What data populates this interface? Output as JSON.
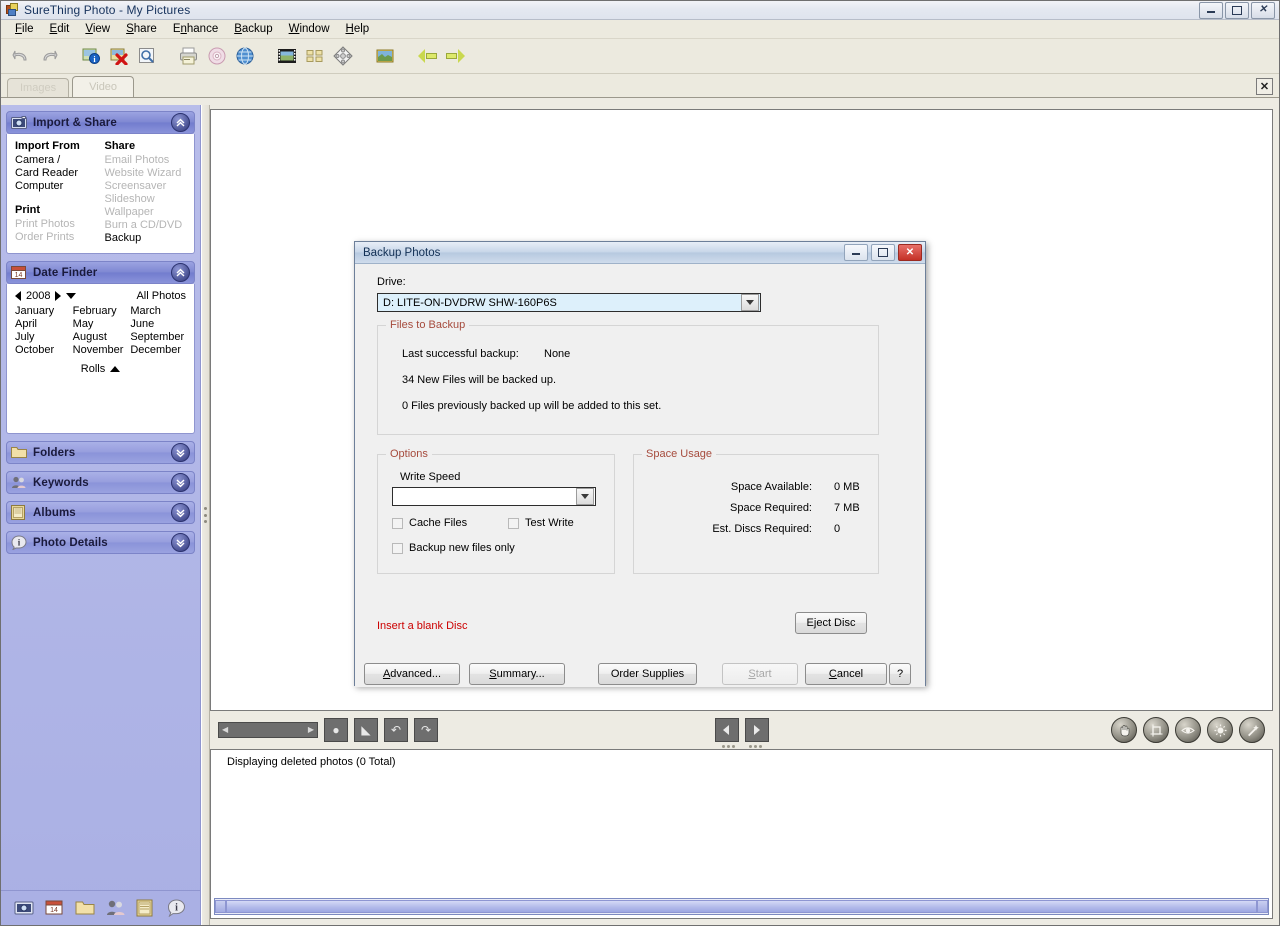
{
  "window": {
    "title": "SureThing Photo - My Pictures",
    "minimize": "Minimize",
    "restore": "Restore",
    "close": "Close"
  },
  "menubar": {
    "items": [
      {
        "label": "File",
        "accel": "F"
      },
      {
        "label": "Edit",
        "accel": "E"
      },
      {
        "label": "View",
        "accel": "V"
      },
      {
        "label": "Share",
        "accel": "S"
      },
      {
        "label": "Enhance",
        "accel": "n"
      },
      {
        "label": "Backup",
        "accel": "B"
      },
      {
        "label": "Window",
        "accel": "W"
      },
      {
        "label": "Help",
        "accel": "H"
      }
    ]
  },
  "toolbar": {
    "buttons": [
      {
        "name": "undo-icon"
      },
      {
        "name": "redo-icon"
      },
      {
        "name": "photo-info-icon"
      },
      {
        "name": "delete-photo-icon"
      },
      {
        "name": "search-icon"
      },
      {
        "name": "print-icon"
      },
      {
        "name": "burn-disc-icon"
      },
      {
        "name": "web-globe-icon"
      },
      {
        "name": "filmstrip-view-icon"
      },
      {
        "name": "thumbnail-view-icon"
      },
      {
        "name": "puzzle-icon"
      },
      {
        "name": "image-icon"
      },
      {
        "name": "back-arrow-icon"
      },
      {
        "name": "forward-arrow-icon"
      }
    ]
  },
  "tabs": {
    "items": [
      {
        "label": "Images",
        "active": false
      },
      {
        "label": "Video",
        "active": true
      }
    ],
    "close_label": "✕"
  },
  "sidebar": {
    "panels": [
      {
        "id": "import-share",
        "title": "Import & Share",
        "icon": "camera-icon",
        "expanded": true,
        "toggle": "«"
      },
      {
        "id": "date-finder",
        "title": "Date Finder",
        "icon": "calendar-icon",
        "expanded": true,
        "toggle": "«"
      },
      {
        "id": "folders",
        "title": "Folders",
        "icon": "folder-icon",
        "expanded": false,
        "toggle": "»"
      },
      {
        "id": "keywords",
        "title": "Keywords",
        "icon": "people-icon",
        "expanded": false,
        "toggle": "»"
      },
      {
        "id": "albums",
        "title": "Albums",
        "icon": "album-icon",
        "expanded": false,
        "toggle": "»"
      },
      {
        "id": "photo-details",
        "title": "Photo Details",
        "icon": "info-icon",
        "expanded": false,
        "toggle": "»"
      }
    ],
    "import_share": {
      "col1_header": "Import From",
      "col1_items": [
        {
          "label": "Camera /",
          "disabled": false
        },
        {
          "label": "Card Reader",
          "disabled": false
        },
        {
          "label": "Computer",
          "disabled": false
        }
      ],
      "col1_header2": "Print",
      "col1_items2": [
        {
          "label": "Print Photos",
          "disabled": true
        },
        {
          "label": "Order Prints",
          "disabled": true
        }
      ],
      "col2_header": "Share",
      "col2_items": [
        {
          "label": "Email Photos",
          "disabled": true
        },
        {
          "label": "Website Wizard",
          "disabled": true
        },
        {
          "label": "Screensaver",
          "disabled": true
        },
        {
          "label": "Slideshow",
          "disabled": true
        },
        {
          "label": "Wallpaper",
          "disabled": true
        },
        {
          "label": "Burn a CD/DVD",
          "disabled": true
        },
        {
          "label": "Backup",
          "disabled": false
        }
      ]
    },
    "date_finder": {
      "year": "2008",
      "prev": "◁",
      "next": "▷",
      "dropdown": "▽",
      "all_photos": "All Photos",
      "months": [
        "January",
        "February",
        "March",
        "April",
        "May",
        "June",
        "July",
        "August",
        "September",
        "October",
        "November",
        "December"
      ],
      "rolls_label": "Rolls",
      "rolls_toggle": "△"
    },
    "bottom_icons": [
      {
        "name": "camera-icon"
      },
      {
        "name": "calendar-icon"
      },
      {
        "name": "folder-icon"
      },
      {
        "name": "people-icon"
      },
      {
        "name": "album-icon"
      },
      {
        "name": "info-icon"
      }
    ]
  },
  "editbar": {
    "zoom_slider": "zoom-slider",
    "buttons": [
      {
        "name": "zoom-fit-icon",
        "glyph": "●"
      },
      {
        "name": "zoom-region-icon",
        "glyph": "◣"
      },
      {
        "name": "rotate-left-icon",
        "glyph": "↶"
      },
      {
        "name": "rotate-right-icon",
        "glyph": "↷"
      }
    ],
    "nav": [
      {
        "name": "previous-photo-button",
        "glyph": "◀"
      },
      {
        "name": "next-photo-button",
        "glyph": "▶"
      }
    ],
    "tools": [
      {
        "name": "hand-tool-icon",
        "glyph": "✋"
      },
      {
        "name": "crop-tool-icon",
        "glyph": "⧉"
      },
      {
        "name": "red-eye-tool-icon",
        "glyph": "◉"
      },
      {
        "name": "brightness-tool-icon",
        "glyph": "☀"
      },
      {
        "name": "magic-wand-tool-icon",
        "glyph": "✦"
      }
    ]
  },
  "status": {
    "text": "Displaying deleted photos (0 Total)"
  },
  "dialog": {
    "title": "Backup Photos",
    "minimize": "Minimize",
    "restore": "Restore",
    "close": "✕",
    "drive_label": "Drive:",
    "drive_value": "D: LITE-ON-DVDRW SHW-160P6S",
    "files_group": {
      "title": "Files to Backup",
      "rows": [
        {
          "label": "Last successful backup:",
          "value": "None"
        },
        {
          "label": "34 New Files will be backed up.",
          "value": ""
        },
        {
          "label": "0 Files previously backed up will be added to this set.",
          "value": ""
        }
      ]
    },
    "options_group": {
      "title": "Options",
      "write_speed_label": "Write Speed",
      "write_speed_value": "",
      "checkboxes": [
        {
          "label": "Cache Files",
          "checked": false
        },
        {
          "label": "Test Write",
          "checked": false
        },
        {
          "label": "Backup new files only",
          "checked": false
        }
      ]
    },
    "space_group": {
      "title": "Space Usage",
      "rows": [
        {
          "label": "Space Available:",
          "value": "0 MB"
        },
        {
          "label": "Space Required:",
          "value": "7 MB"
        },
        {
          "label": "Est. Discs Required:",
          "value": "0"
        }
      ]
    },
    "warning": "Insert a blank Disc",
    "eject_button": "Eject Disc",
    "buttons": [
      {
        "label": "Advanced...",
        "accel": "A",
        "disabled": false,
        "name": "advanced-button"
      },
      {
        "label": "Summary...",
        "accel": "S",
        "disabled": false,
        "name": "summary-button"
      },
      {
        "label": "Order Supplies",
        "accel": "",
        "disabled": false,
        "name": "order-supplies-button"
      },
      {
        "label": "Start",
        "accel": "S",
        "disabled": true,
        "name": "start-button"
      },
      {
        "label": "Cancel",
        "accel": "C",
        "disabled": false,
        "name": "cancel-button"
      },
      {
        "label": "?",
        "accel": "",
        "disabled": false,
        "name": "help-button"
      }
    ]
  },
  "colors": {
    "sidebar": "#aeb4e8",
    "group_title": "#a64b3d",
    "warning": "#cc0000",
    "title_text": "#16325c"
  }
}
